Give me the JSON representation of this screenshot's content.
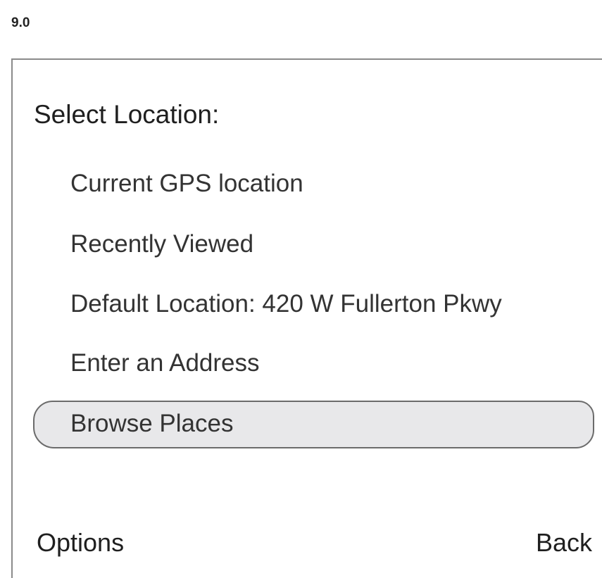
{
  "version": "9.0",
  "screen": {
    "title": "Select Location:"
  },
  "menu": {
    "items": [
      {
        "label": "Current GPS location"
      },
      {
        "label": "Recently Viewed"
      },
      {
        "label": "Default Location: 420 W Fullerton Pkwy"
      },
      {
        "label": "Enter an Address"
      },
      {
        "label": "Browse Places",
        "selected": true
      }
    ]
  },
  "softkeys": {
    "left": "Options",
    "right": "Back"
  },
  "colors": {
    "highlight_fill": "#e8e8ea",
    "highlight_border": "#6b6b6b",
    "frame_border": "#8a8a8a"
  }
}
